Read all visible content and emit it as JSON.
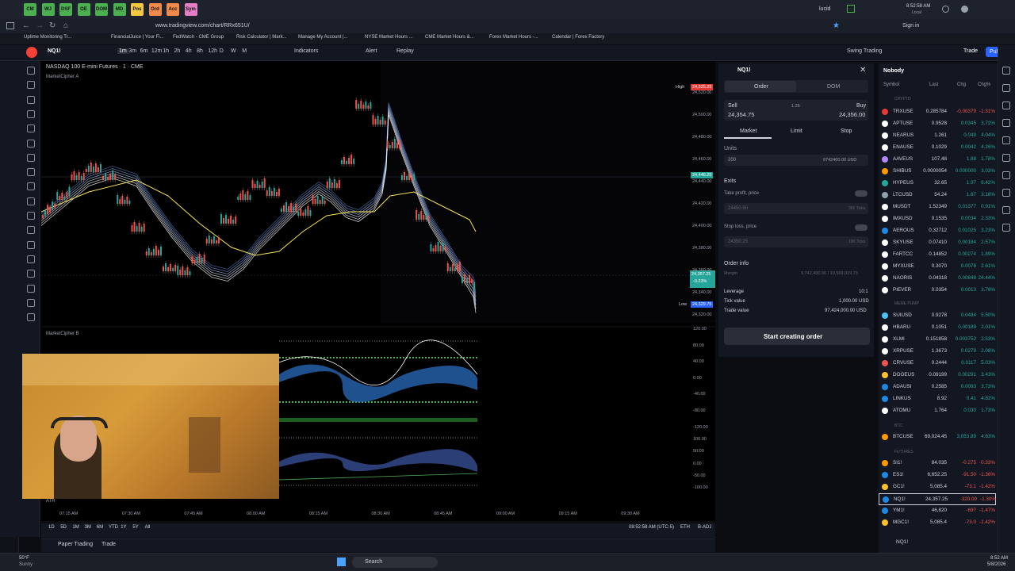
{
  "system_tabs": [
    {
      "label": "CM",
      "color": "#4caf50"
    },
    {
      "label": "WJ",
      "color": "#4caf50"
    },
    {
      "label": "DSF",
      "color": "#4caf50"
    },
    {
      "label": "OE",
      "color": "#4caf50"
    },
    {
      "label": "DOM",
      "color": "#4caf50"
    },
    {
      "label": "MD",
      "color": "#4caf50"
    },
    {
      "label": "Pos",
      "color": "#f5c842"
    },
    {
      "label": "Ord",
      "color": "#f08a4b"
    },
    {
      "label": "Acc",
      "color": "#f08a4b"
    },
    {
      "label": "Sym",
      "color": "#e57dc5"
    }
  ],
  "system": {
    "account": "lucid",
    "clock": "8:52:58 AM",
    "clock_sub": "Local"
  },
  "browser": {
    "url": "www.tradingview.com/chart/RRx651U/",
    "sign_in": "Sign in"
  },
  "bookmarks": [
    "Uptime Monitoring Tr...",
    "FinancialJuice | Your Fi...",
    "FedWatch - CME Group",
    "Risk Calculator | Mark...",
    "Manage My Account |...",
    "NYSE Market Hours ...",
    "CME Market Hours &...",
    "Forex Market Hours -...",
    "Calendar | Forex Factory"
  ],
  "toolbar": {
    "symbol": "NQ1!",
    "timeframes": [
      "1m",
      "3m",
      "6m",
      "12m",
      "1h",
      "2h",
      "4h",
      "8h",
      "12h",
      "D",
      "W",
      "M"
    ],
    "indicators": "Indicators",
    "alert": "Alert",
    "replay": "Replay",
    "swing": "Swing Trading",
    "trade": "Trade",
    "publish": "Publish"
  },
  "chart": {
    "title": "NASDAQ 100 E-mini Futures · 1 · CME",
    "indicator_a": "MarketCipher A",
    "indicator_b": "MarketCipher B",
    "atr": "ATR",
    "high_label": "High",
    "high_value": "24,525.25",
    "low_label": "Low",
    "low_value": "24,329.75",
    "last_price": "24,357.25",
    "last_change": "-0.23%",
    "mark_price": "24,446.25",
    "price_ticks": [
      "24,520.00",
      "24,500.00",
      "24,480.00",
      "24,460.00",
      "24,440.00",
      "24,420.00",
      "24,400.00",
      "24,380.00",
      "24,360.00",
      "24,340.00",
      "24,320.00"
    ],
    "osc_ticks": [
      "120.00",
      "80.00",
      "40.00",
      "0.00",
      "-40.00",
      "-80.00",
      "-120.00"
    ],
    "osc2_ticks": [
      "100.00",
      "50.00",
      "0.00",
      "-50.00",
      "-100.00"
    ],
    "time_ticks": [
      "07:15 AM",
      "07:30 AM",
      "07:45 AM",
      "08:00 AM",
      "08:15 AM",
      "08:30 AM",
      "08:45 AM",
      "09:00 AM",
      "09:15 AM",
      "09:30 AM"
    ],
    "ranges": [
      "1D",
      "5D",
      "1M",
      "3M",
      "6M",
      "YTD",
      "1Y",
      "5Y",
      "All"
    ],
    "utc": "08:52:58 AM (UTC-5)",
    "session": "ETH",
    "adj": "B-ADJ",
    "paper": "Paper Trading",
    "trade_tab": "Trade"
  },
  "order_panel": {
    "symbol": "NQ1!",
    "tab_order": "Order",
    "tab_dom": "DOM",
    "sell_label": "Sell",
    "sell_price": "24,354.75",
    "spread": "1.25",
    "buy_label": "Buy",
    "buy_price": "24,356.00",
    "types": [
      "Market",
      "Limit",
      "Stop"
    ],
    "units_label": "Units",
    "units_value": "200",
    "notional": "9742400.00 USD",
    "exits": "Exits",
    "tp_label": "Take profit, price",
    "tp_value": "24450.50",
    "tp_ticks": "301 Ticks",
    "sl_label": "Stop loss, price",
    "sl_value": "24350.25",
    "sl_ticks": "100 Ticks",
    "info": "Order info",
    "margin_label": "Margin",
    "margin_value": "9,742,400.00 / 10,569,019.73",
    "leverage_label": "Leverage",
    "leverage_value": "10:1",
    "tick_label": "Tick value",
    "tick_value": "1,000.00 USD",
    "trade_label": "Trade value",
    "trade_value": "97,424,000.00 USD",
    "start": "Start creating order"
  },
  "watchlist": {
    "title": "Nobody",
    "cols": [
      "Symbol",
      "Last",
      "Chg",
      "Chg%"
    ],
    "sections": {
      "crypto": "CRYPTO",
      "meme": "MEME PUMP",
      "btc": "BTC",
      "futures": "FUTURES"
    },
    "crypto": [
      {
        "s": "TRXUSE",
        "l": "0.285784",
        "c": "-0.00379",
        "p": "-1.31%",
        "up": false,
        "col": "#e53935"
      },
      {
        "s": "APTUSE",
        "l": "0.9528",
        "c": "0.0345",
        "p": "3.72%",
        "up": true,
        "col": "#ffffff"
      },
      {
        "s": "NEARUS",
        "l": "1.261",
        "c": "0.049",
        "p": "4.04%",
        "up": true,
        "col": "#ffffff"
      },
      {
        "s": "ENAUSE",
        "l": "0.1029",
        "c": "0.0042",
        "p": "4.26%",
        "up": true,
        "col": "#ffffff"
      },
      {
        "s": "AAVEUS",
        "l": "107.48",
        "c": "1.88",
        "p": "1.78%",
        "up": true,
        "col": "#b388ff"
      },
      {
        "s": "SHIBUS",
        "l": "0.0000054",
        "c": "0.000000",
        "p": "3.03%",
        "up": true,
        "col": "#ff9800"
      },
      {
        "s": "HYPEUS",
        "l": "32.65",
        "c": "1.97",
        "p": "6.42%",
        "up": true,
        "col": "#26a69a"
      },
      {
        "s": "LTCUSD",
        "l": "54.24",
        "c": "1.67",
        "p": "3.18%",
        "up": true,
        "col": "#90a4ae"
      },
      {
        "s": "MUSDT",
        "l": "1.52349",
        "c": "0.01377",
        "p": "0.91%",
        "up": true,
        "col": "#ffffff"
      },
      {
        "s": "IMXUSD",
        "l": "0.1535",
        "c": "0.0034",
        "p": "2.33%",
        "up": true,
        "col": "#ffffff"
      },
      {
        "s": "AEROUS",
        "l": "0.32712",
        "c": "0.01025",
        "p": "3.23%",
        "up": true,
        "col": "#1e88e5"
      },
      {
        "s": "SKYUSE",
        "l": "0.07410",
        "c": "0.00184",
        "p": "2.57%",
        "up": true,
        "col": "#ffffff"
      },
      {
        "s": "FARTCC",
        "l": "0.14852",
        "c": "0.00274",
        "p": "1.89%",
        "up": true,
        "col": "#ffffff"
      },
      {
        "s": "MYXUSE",
        "l": "0.3070",
        "c": "0.0078",
        "p": "2.61%",
        "up": true,
        "col": "#ffffff"
      },
      {
        "s": "NAORIS",
        "l": "0.04318",
        "c": "0.00848",
        "p": "24.44%",
        "up": true,
        "col": "#ffffff"
      },
      {
        "s": "PIEVER",
        "l": "0.0354",
        "c": "0.0013",
        "p": "3.76%",
        "up": true,
        "col": "#ffffff"
      }
    ],
    "meme": [
      {
        "s": "SUIUSD",
        "l": "0.9278",
        "c": "0.0484",
        "p": "5.50%",
        "up": true,
        "col": "#4fc3f7"
      },
      {
        "s": "HBARU",
        "l": "0.1051",
        "c": "0.00189",
        "p": "2.01%",
        "up": true,
        "col": "#ffffff"
      },
      {
        "s": "XLMI",
        "l": "0.151858",
        "c": "0.003752",
        "p": "2.53%",
        "up": true,
        "col": "#ffffff"
      },
      {
        "s": "XRPUSE",
        "l": "1.3673",
        "c": "0.0279",
        "p": "2.08%",
        "up": true,
        "col": "#ffffff"
      },
      {
        "s": "CRVUSE",
        "l": "0.2444",
        "c": "0.0117",
        "p": "5.03%",
        "up": true,
        "col": "#ef5350"
      },
      {
        "s": "DOGEUS",
        "l": "0.09199",
        "c": "0.00291",
        "p": "3.43%",
        "up": true,
        "col": "#fbc02d"
      },
      {
        "s": "ADAUSI",
        "l": "0.2585",
        "c": "0.0093",
        "p": "3.73%",
        "up": true,
        "col": "#1e88e5"
      },
      {
        "s": "LINKUS",
        "l": "8.92",
        "c": "0.41",
        "p": "4.82%",
        "up": true,
        "col": "#1e88e5"
      },
      {
        "s": "ATOMU",
        "l": "1.764",
        "c": "0.030",
        "p": "1.73%",
        "up": true,
        "col": "#ffffff"
      }
    ],
    "btc": [
      {
        "s": "BTCUSE",
        "l": "69,024.45",
        "c": "3,053.89",
        "p": "4.63%",
        "up": true,
        "col": "#ff9800"
      }
    ],
    "futures": [
      {
        "s": "SI1!",
        "l": "84.035",
        "c": "-0.275",
        "p": "-0.33%",
        "up": false,
        "col": "#ff9800"
      },
      {
        "s": "ES1!",
        "l": "6,652.25",
        "c": "-91.50",
        "p": "-1.36%",
        "up": false,
        "col": "#1e88e5"
      },
      {
        "s": "GC1!",
        "l": "5,085.4",
        "c": "-73.1",
        "p": "-1.42%",
        "up": false,
        "col": "#fbc02d"
      },
      {
        "s": "NQ1!",
        "l": "24,357.25",
        "c": "-320.00",
        "p": "-1.30%",
        "up": false,
        "col": "#1e88e5"
      },
      {
        "s": "YM1!",
        "l": "46,820",
        "c": "-697",
        "p": "-1.47%",
        "up": false,
        "col": "#1e88e5"
      },
      {
        "s": "MGC1!",
        "l": "5,085.4",
        "c": "-73.0",
        "p": "-1.42%",
        "up": false,
        "col": "#fbc02d"
      }
    ],
    "footer_symbol": "NQ1!"
  },
  "taskbar": {
    "weather_temp": "50°F",
    "weather": "Sunny",
    "search": "Search",
    "time": "8:52 AM",
    "date": "5/8/2026"
  }
}
